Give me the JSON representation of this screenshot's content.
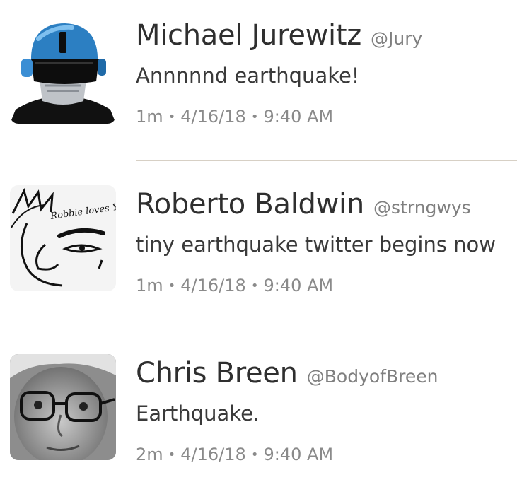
{
  "tweets": [
    {
      "name": "Michael Jurewitz",
      "handle": "@Jury",
      "text": "Annnnnd earthquake!",
      "age": "1m",
      "date": "4/16/18",
      "time": "9:40 AM",
      "avatar_icon": "robot-helmet-avatar"
    },
    {
      "name": "Roberto Baldwin",
      "handle": "@strngwys",
      "text": "tiny earthquake twitter begins now",
      "age": "1m",
      "date": "4/16/18",
      "time": "9:40 AM",
      "avatar_icon": "sketch-face-avatar",
      "avatar_text": "Robbie loves You!!"
    },
    {
      "name": "Chris Breen",
      "handle": "@BodyofBreen",
      "text": "Earthquake.",
      "age": "2m",
      "date": "4/16/18",
      "time": "9:40 AM",
      "avatar_icon": "glasses-face-avatar"
    }
  ],
  "separator": "•"
}
